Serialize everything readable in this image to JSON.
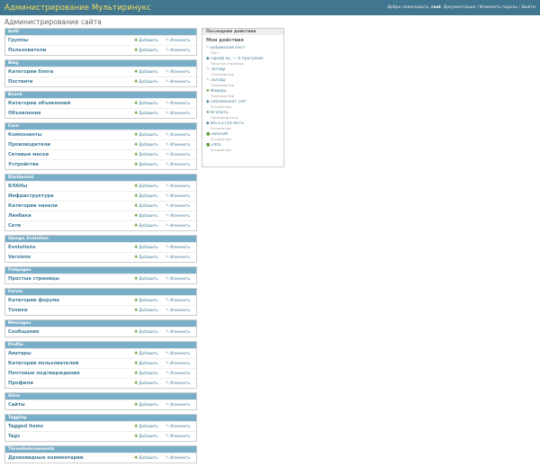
{
  "header": {
    "site_title": "Администрирование Мультиринукс",
    "welcome": "Добро пожаловать,",
    "username": "root",
    "docs": "Документация",
    "change_password": "Изменить пароль",
    "logout": "Выйти",
    "separator": "/"
  },
  "page_title": "Администрирование сайта",
  "labels": {
    "add": "Добавить",
    "change": "Изменить"
  },
  "modules": [
    {
      "caption": "Auth",
      "models": [
        "Группы",
        "Пользователи"
      ]
    },
    {
      "caption": "Blog",
      "models": [
        "Категории блога",
        "Постинги"
      ]
    },
    {
      "caption": "Board",
      "models": [
        "Категории объявлений",
        "Объявления"
      ]
    },
    {
      "caption": "Core",
      "models": [
        "Компоненты",
        "Производители",
        "Сетевые маски",
        "Устройства"
      ]
    },
    {
      "caption": "Dashboard",
      "models": [
        "ВЛАНы",
        "Инфраструктура",
        "Категории панели",
        "Линбаки",
        "Сети"
      ]
    },
    {
      "caption": "Django_Evolution",
      "models": [
        "Evolutions",
        "Versions"
      ]
    },
    {
      "caption": "Flatpages",
      "models": [
        "Простые страницы"
      ]
    },
    {
      "caption": "Forum",
      "models": [
        "Категории форума",
        "Топики"
      ]
    },
    {
      "caption": "Messages",
      "models": [
        "Сообщения"
      ]
    },
    {
      "caption": "Profile",
      "models": [
        "Аватары",
        "Категории пользователей",
        "Почтовые подтверждения",
        "Профили"
      ]
    },
    {
      "caption": "Sites",
      "models": [
        "Сайты"
      ]
    },
    {
      "caption": "Tagging",
      "models": [
        "Tagged items",
        "Tags"
      ]
    },
    {
      "caption": "Threadedcomments",
      "models": [
        "Древовидные комментарии"
      ]
    }
  ],
  "recent": {
    "title": "Последние действия",
    "my_actions": "Мои действия",
    "items": [
      {
        "icon": "change",
        "label": "Бобийский пост",
        "type": "Пост"
      },
      {
        "icon": "delete",
        "label": "Тариф БС — 0 программ",
        "type": "Простая страница"
      },
      {
        "icon": "change",
        "label": "Заговр",
        "type": "Топикмастер"
      },
      {
        "icon": "change",
        "label": "Заговр",
        "type": "Топикмастер"
      },
      {
        "icon": "add",
        "label": "Фаворь",
        "type": "Топикмастер"
      },
      {
        "icon": "delete",
        "label": "1001Вокмат 10Р",
        "type": "Устройство"
      },
      {
        "icon": "add",
        "label": "Кгопить",
        "type": "Производитель"
      },
      {
        "icon": "delete",
        "label": "WS-C2750-40TS",
        "type": "Устройство"
      },
      {
        "icon": "square",
        "label": "2691SM",
        "type": "Устройство"
      },
      {
        "icon": "square",
        "label": "2901",
        "type": "Устройство"
      }
    ]
  }
}
